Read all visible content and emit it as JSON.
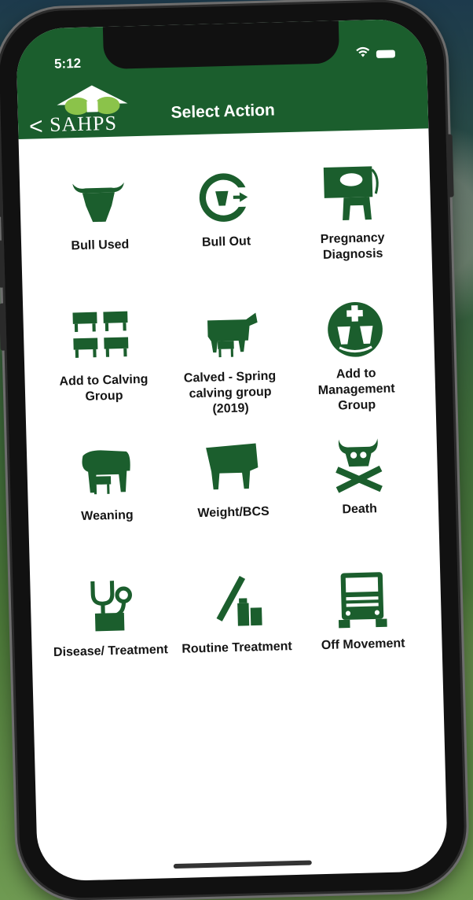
{
  "status": {
    "time": "5:12"
  },
  "header": {
    "back_glyph": "<",
    "logo_text": "SAHPS",
    "title": "Select Action",
    "color": "#1b5e2d"
  },
  "actions": [
    {
      "label": "Bull Used",
      "icon": "bull-head-icon"
    },
    {
      "label": "Bull Out",
      "icon": "bull-out-icon"
    },
    {
      "label": "Pregnancy Diagnosis",
      "icon": "pregnancy-icon"
    },
    {
      "label": "Add to Calving Group",
      "icon": "calving-group-icon"
    },
    {
      "label": "Calved - Spring calving group (2019)",
      "icon": "cow-calf-icon"
    },
    {
      "label": "Add to Management Group",
      "icon": "management-group-icon"
    },
    {
      "label": "Weaning",
      "icon": "weaning-icon"
    },
    {
      "label": "Weight/BCS",
      "icon": "weight-icon"
    },
    {
      "label": "Death",
      "icon": "skull-crossbones-icon"
    },
    {
      "label": "Disease/ Treatment",
      "icon": "stethoscope-icon"
    },
    {
      "label": "Routine Treatment",
      "icon": "syringe-icon"
    },
    {
      "label": "Off Movement",
      "icon": "truck-icon"
    }
  ]
}
